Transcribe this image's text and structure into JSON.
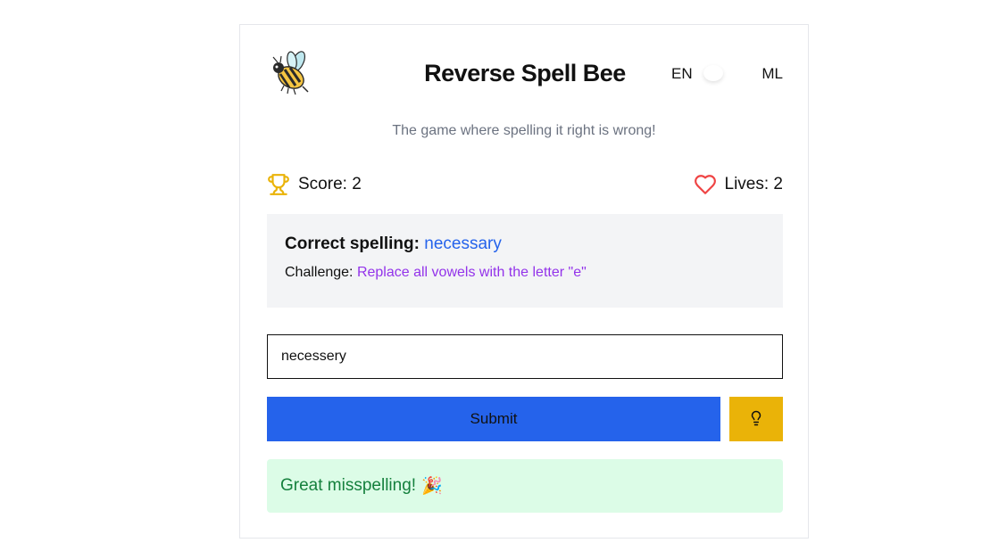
{
  "header": {
    "title": "Reverse Spell Bee",
    "logo_icon": "bee-icon",
    "language": {
      "left_label": "EN",
      "right_label": "ML"
    }
  },
  "subtitle": "The game where spelling it right is wrong!",
  "stats": {
    "score_label": "Score: 2",
    "score_icon": "trophy-icon",
    "lives_label": "Lives: 2",
    "lives_icon": "heart-icon"
  },
  "challenge": {
    "correct_prefix": "Correct spelling:",
    "correct_word": "necessary",
    "challenge_prefix": "Challenge:",
    "challenge_text": "Replace all vowels with the letter \"e\""
  },
  "answer_input": {
    "value": "necessery"
  },
  "buttons": {
    "submit_label": "Submit",
    "hint_icon": "lightbulb-icon"
  },
  "feedback": {
    "message": "Great misspelling!",
    "emoji": "🎉"
  },
  "colors": {
    "primary": "#2563eb",
    "hint": "#eab308",
    "success_bg": "#dcfce7",
    "success_text": "#15803d",
    "challenge_text": "#9333ea",
    "heart": "#ef4444",
    "trophy": "#eab308"
  }
}
